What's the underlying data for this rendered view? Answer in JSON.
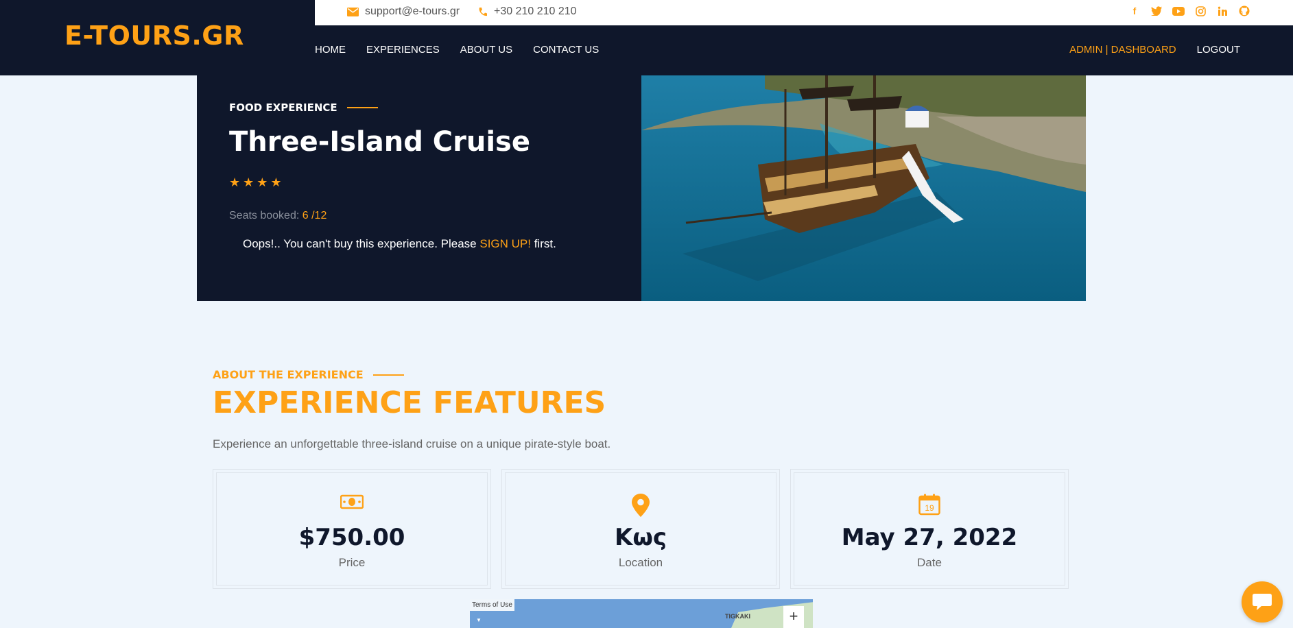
{
  "brand": {
    "logo": "E-TOURS.GR",
    "accent": "#fea116",
    "dark": "#0f172b"
  },
  "topbar": {
    "email": "support@e-tours.gr",
    "phone": "+30 210 210 210",
    "socials": [
      "facebook-icon",
      "twitter-icon",
      "youtube-icon",
      "instagram-icon",
      "linkedin-icon",
      "github-icon"
    ]
  },
  "nav": {
    "items": [
      "HOME",
      "EXPERIENCES",
      "ABOUT US",
      "CONTACT US"
    ],
    "admin": "ADMIN | DASHBOARD",
    "logout": "LOGOUT"
  },
  "hero": {
    "category": "FOOD EXPERIENCE",
    "title": "Three-Island Cruise",
    "rating": 4,
    "seats_label": "Seats booked:",
    "seats_value": "6 /12",
    "oops_before": "Oops!.. You can't buy this experience. Please ",
    "signup": "SIGN UP!",
    "oops_after": " first."
  },
  "about": {
    "eyebrow": "ABOUT THE EXPERIENCE",
    "title": "EXPERIENCE FEATURES",
    "description": "Experience an unforgettable three-island cruise on a unique pirate-style boat."
  },
  "features": [
    {
      "icon": "money-icon",
      "value": "$750.00",
      "label": "Price"
    },
    {
      "icon": "location-pin-icon",
      "value": "Κως",
      "label": "Location"
    },
    {
      "icon": "calendar-icon",
      "value": "May 27, 2022",
      "label": "Date",
      "calendar_day": "19"
    }
  ],
  "map": {
    "terms": "Terms of Use",
    "place": "TIGKAKI",
    "zoom_in": "+"
  }
}
